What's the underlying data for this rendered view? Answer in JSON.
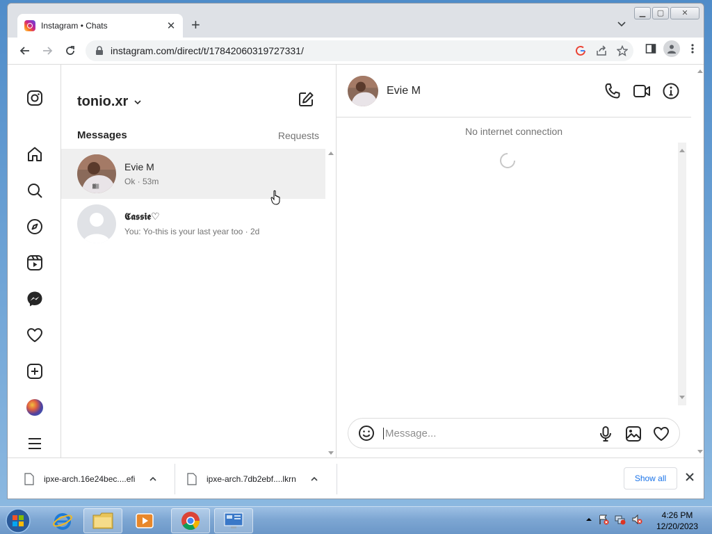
{
  "browser": {
    "tab_title": "Instagram • Chats",
    "url": "instagram.com/direct/t/17842060319727331/"
  },
  "inbox": {
    "username": "tonio.xr",
    "messages_heading": "Messages",
    "requests_label": "Requests",
    "threads": [
      {
        "name": "Evie M",
        "preview": "Ok · 53m"
      },
      {
        "name": "𝕮𝖆𝖘𝖘𝖎𝖊♡",
        "preview": "You: Yo-this is your last year too · 2d"
      }
    ]
  },
  "chat": {
    "contact_name": "Evie M",
    "status_text": "No internet connection",
    "composer_placeholder": "Message..."
  },
  "downloads": {
    "items": [
      {
        "name": "ipxe-arch.16e24bec....efi"
      },
      {
        "name": "ipxe-arch.7db2ebf....lkrn"
      }
    ],
    "show_all_label": "Show all"
  },
  "taskbar": {
    "time": "4:26 PM",
    "date": "12/20/2023"
  },
  "icons": {
    "rail": [
      "instagram-icon",
      "home-icon",
      "search-icon",
      "explore-icon",
      "reels-icon",
      "messenger-icon",
      "notifications-icon",
      "create-icon",
      "profile-avatar",
      "more-menu-icon"
    ]
  },
  "colors": {
    "accent_blue": "#1a73e8",
    "active_thread_bg": "#efefef",
    "border": "#dbdbdb"
  }
}
